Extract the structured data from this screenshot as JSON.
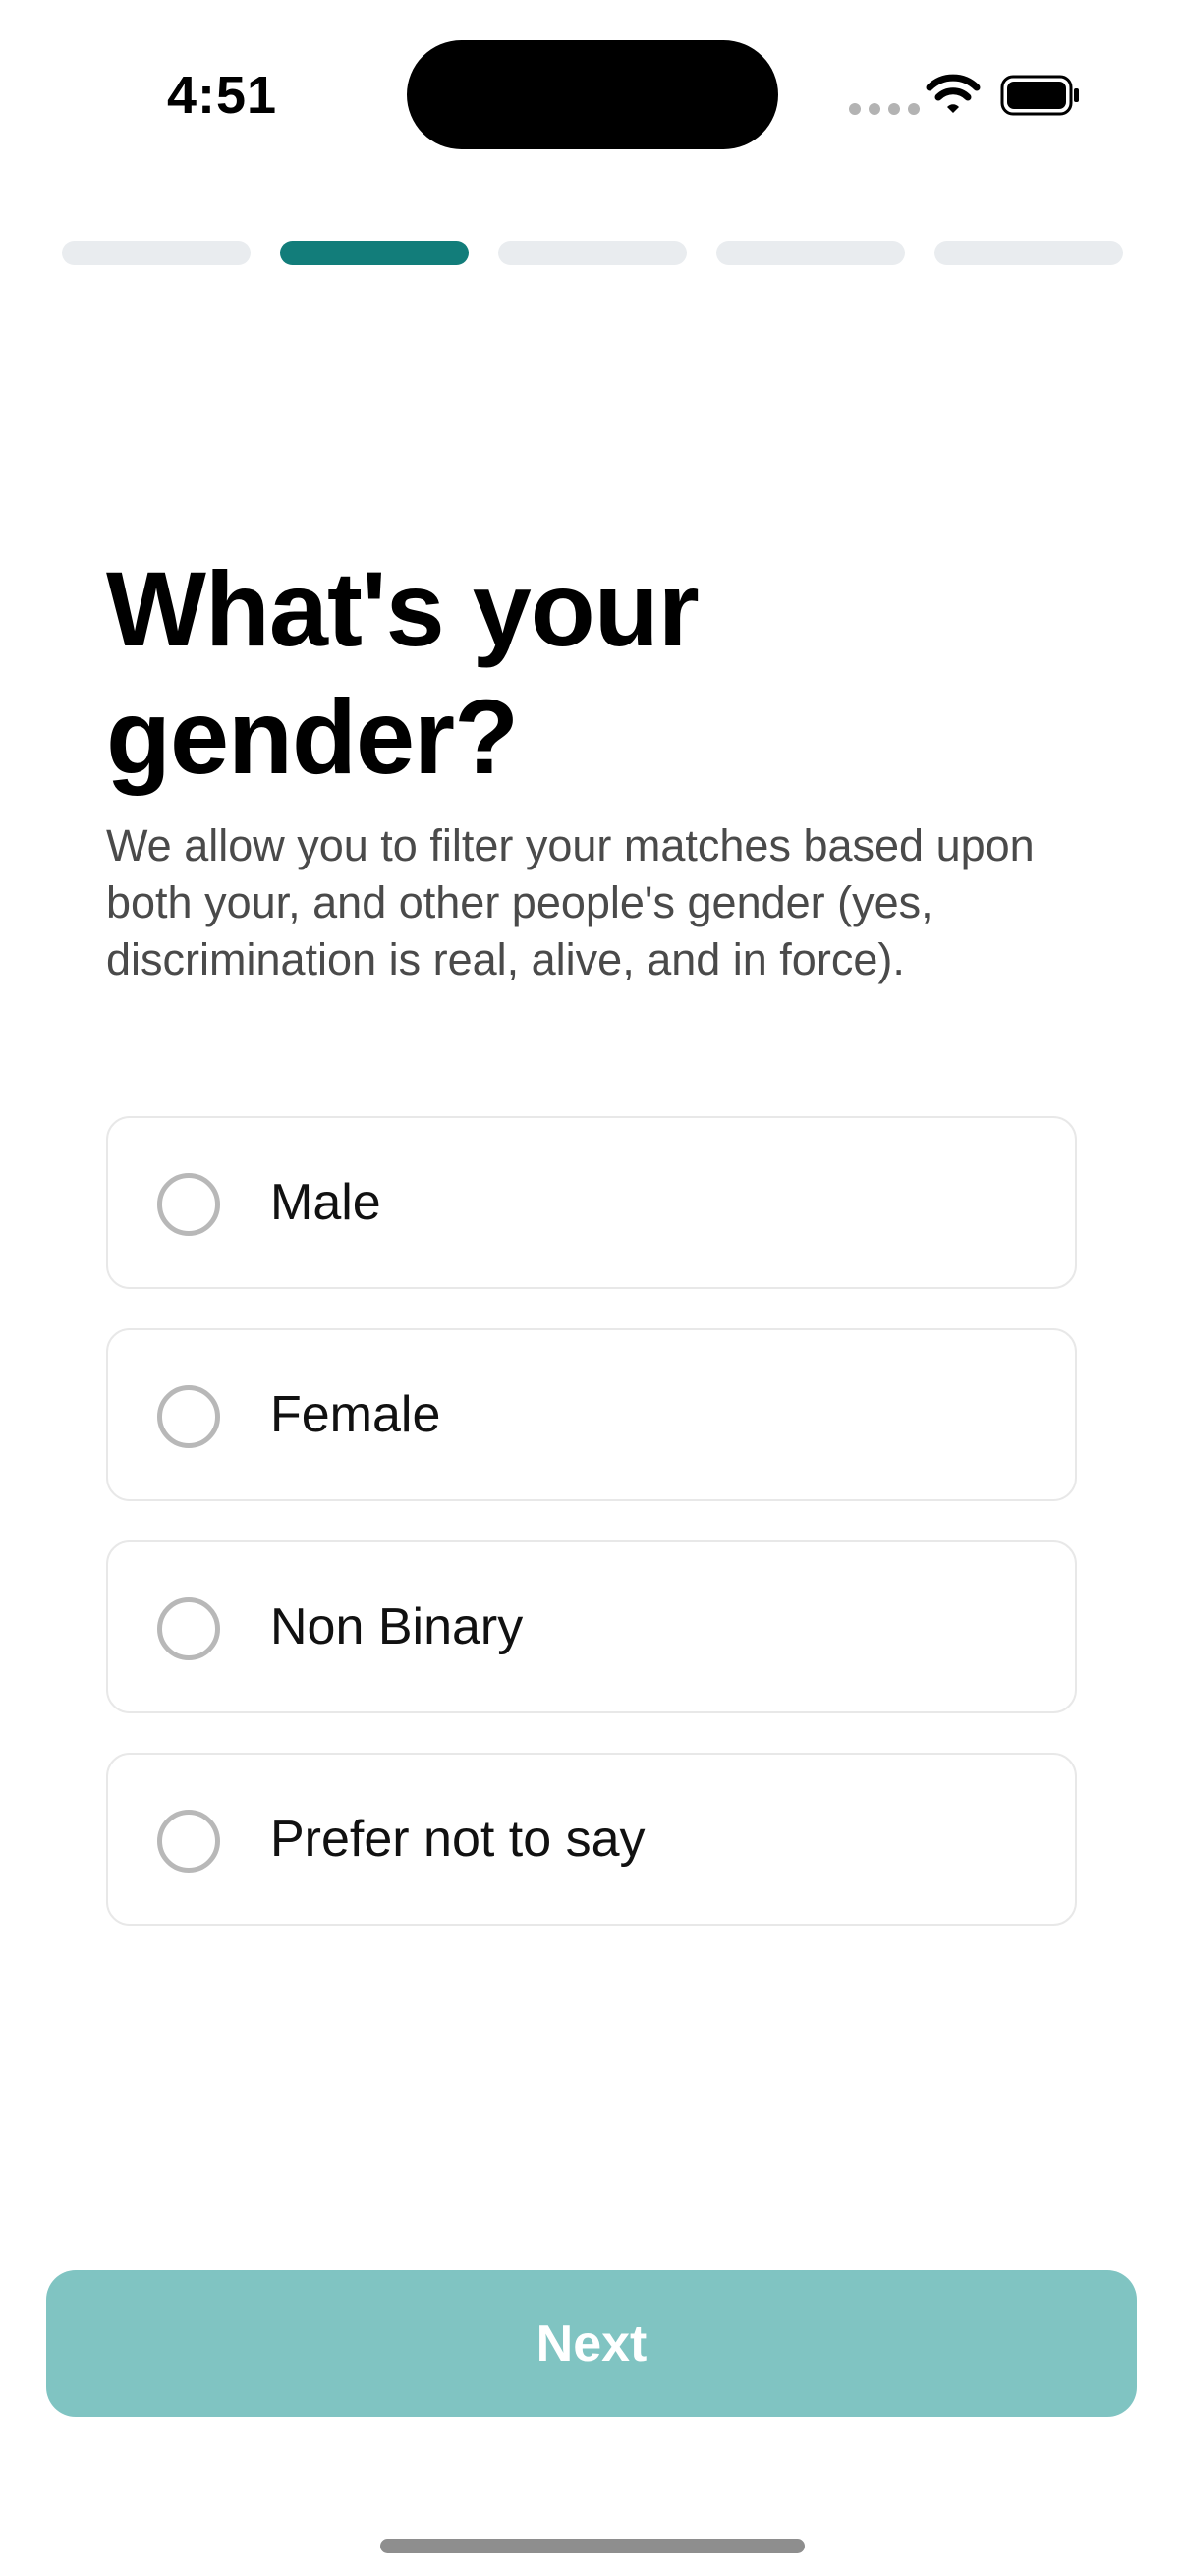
{
  "status_bar": {
    "time": "4:51"
  },
  "progress": {
    "total_steps": 5,
    "current_step": 2
  },
  "question": {
    "title": "What's your gender?",
    "description": "We allow you to filter your matches based upon both your, and other people's gender (yes, discrimination is real, alive, and in force)."
  },
  "options": [
    {
      "label": "Male",
      "selected": false
    },
    {
      "label": "Female",
      "selected": false
    },
    {
      "label": "Non Binary",
      "selected": false
    },
    {
      "label": "Prefer not to say",
      "selected": false
    }
  ],
  "next_button": {
    "label": "Next",
    "enabled": false
  },
  "colors": {
    "accent": "#127d7a",
    "button_disabled": "#80c4c2",
    "track": "#e9ecef"
  }
}
